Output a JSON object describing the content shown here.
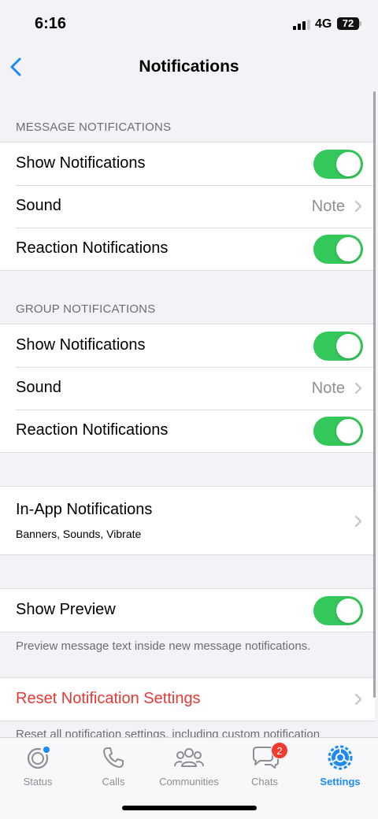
{
  "status_bar": {
    "time": "6:16",
    "network": "4G",
    "battery": "72"
  },
  "nav": {
    "title": "Notifications",
    "back_icon": "chevron-left-icon"
  },
  "message_section": {
    "header": "MESSAGE NOTIFICATIONS",
    "show_notifications": {
      "label": "Show Notifications",
      "on": true
    },
    "sound": {
      "label": "Sound",
      "value": "Note"
    },
    "reaction_notifications": {
      "label": "Reaction Notifications",
      "on": true
    }
  },
  "group_section": {
    "header": "GROUP NOTIFICATIONS",
    "show_notifications": {
      "label": "Show Notifications",
      "on": true
    },
    "sound": {
      "label": "Sound",
      "value": "Note"
    },
    "reaction_notifications": {
      "label": "Reaction Notifications",
      "on": true
    }
  },
  "in_app": {
    "label": "In-App Notifications",
    "sublabel": "Banners, Sounds, Vibrate"
  },
  "preview": {
    "label": "Show Preview",
    "on": true,
    "footer": "Preview message text inside new message notifications."
  },
  "reset": {
    "label": "Reset Notification Settings",
    "footer": "Reset all notification settings, including custom notification"
  },
  "tabs": [
    {
      "label": "Status",
      "icon": "status-icon"
    },
    {
      "label": "Calls",
      "icon": "phone-icon"
    },
    {
      "label": "Communities",
      "icon": "communities-icon"
    },
    {
      "label": "Chats",
      "icon": "chat-bubbles-icon",
      "badge": "2"
    },
    {
      "label": "Settings",
      "icon": "gear-icon",
      "active": true
    }
  ],
  "colors": {
    "accent": "#1d8af5",
    "toggle_on": "#34c759",
    "danger": "#e53935",
    "badge": "#f33a30"
  }
}
